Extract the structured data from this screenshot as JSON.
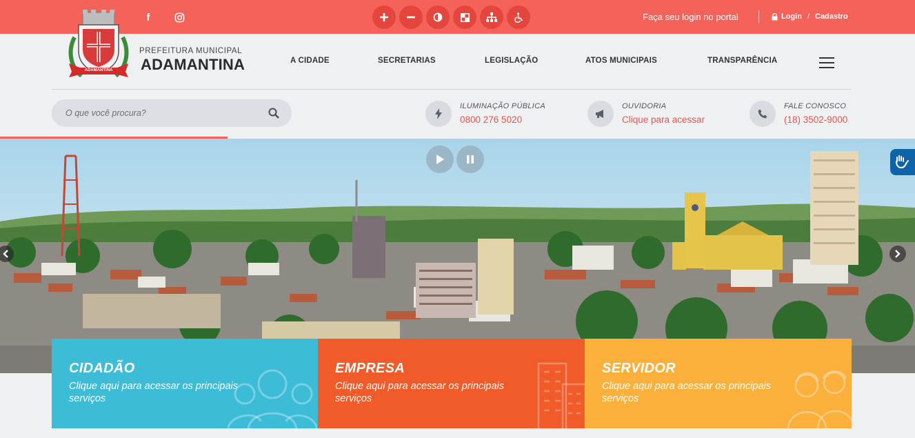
{
  "colors": {
    "topbar": "#f4625a",
    "accent_text": "#e8534b",
    "card_cidadao": "#3dbcd7",
    "card_empresa": "#f15a29",
    "card_servidor": "#fbb03b"
  },
  "topbar": {
    "social": [
      {
        "name": "facebook-icon",
        "glyph": "f"
      },
      {
        "name": "instagram-icon"
      }
    ],
    "accessibility": [
      {
        "name": "increase-font-icon"
      },
      {
        "name": "decrease-font-icon"
      },
      {
        "name": "contrast-icon"
      },
      {
        "name": "high-contrast-icon"
      },
      {
        "name": "sitemap-icon"
      },
      {
        "name": "wheelchair-icon"
      }
    ],
    "login_prompt": "Faça seu login no portal",
    "login_label": "Login",
    "separator": "/",
    "register_label": "Cadastro"
  },
  "header": {
    "logo_ribbon": "ADAMANTINA",
    "brand_sub": "PREFEITURA MUNICIPAL",
    "brand_main": "ADAMANTINA",
    "nav": [
      "A CIDADE",
      "SECRETARIAS",
      "LEGISLAÇÃO",
      "ATOS MUNICIPAIS",
      "TRANSPARÊNCIA"
    ]
  },
  "search": {
    "placeholder": "O que você procura?"
  },
  "contacts": [
    {
      "icon": "lightning-icon",
      "label": "ILUMINAÇÃO PÚBLICA",
      "value": "0800 276 5020"
    },
    {
      "icon": "megaphone-icon",
      "label": "OUVIDORIA",
      "value": "Clique para acessar"
    },
    {
      "icon": "phone-icon",
      "label": "FALE CONOSCO",
      "value": "(18) 3502-9000"
    }
  ],
  "cards": [
    {
      "title": "CIDADÃO",
      "desc": "Clique aqui para acessar os principais serviços"
    },
    {
      "title": "EMPRESA",
      "desc": "Clique aqui para acessar os principais serviços"
    },
    {
      "title": "SERVIDOR",
      "desc": "Clique aqui para acessar os principais serviços"
    }
  ]
}
